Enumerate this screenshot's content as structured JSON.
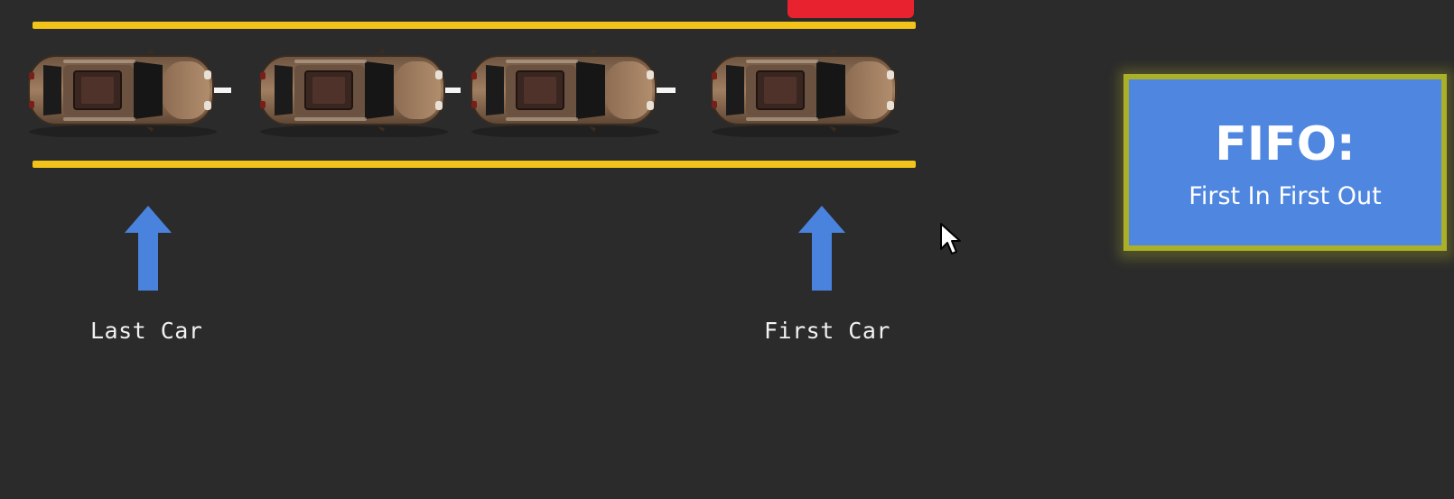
{
  "labels": {
    "last_car": "Last Car",
    "first_car": "First Car"
  },
  "fifo": {
    "title": "FIFO:",
    "subtitle": "First In First Out"
  },
  "cars": [
    {
      "name": "car-1"
    },
    {
      "name": "car-2"
    },
    {
      "name": "car-3"
    },
    {
      "name": "car-4"
    }
  ],
  "colors": {
    "background": "#2b2b2b",
    "lane_line": "#f2c318",
    "arrow": "#4a83de",
    "fifo_box": "#4f86e0",
    "fifo_border": "#aab027",
    "car_body": "#8a6a4e",
    "red_tab": "#e8232f"
  },
  "icons": {
    "arrow": "arrow-up-icon",
    "cursor": "mouse-pointer-icon"
  }
}
